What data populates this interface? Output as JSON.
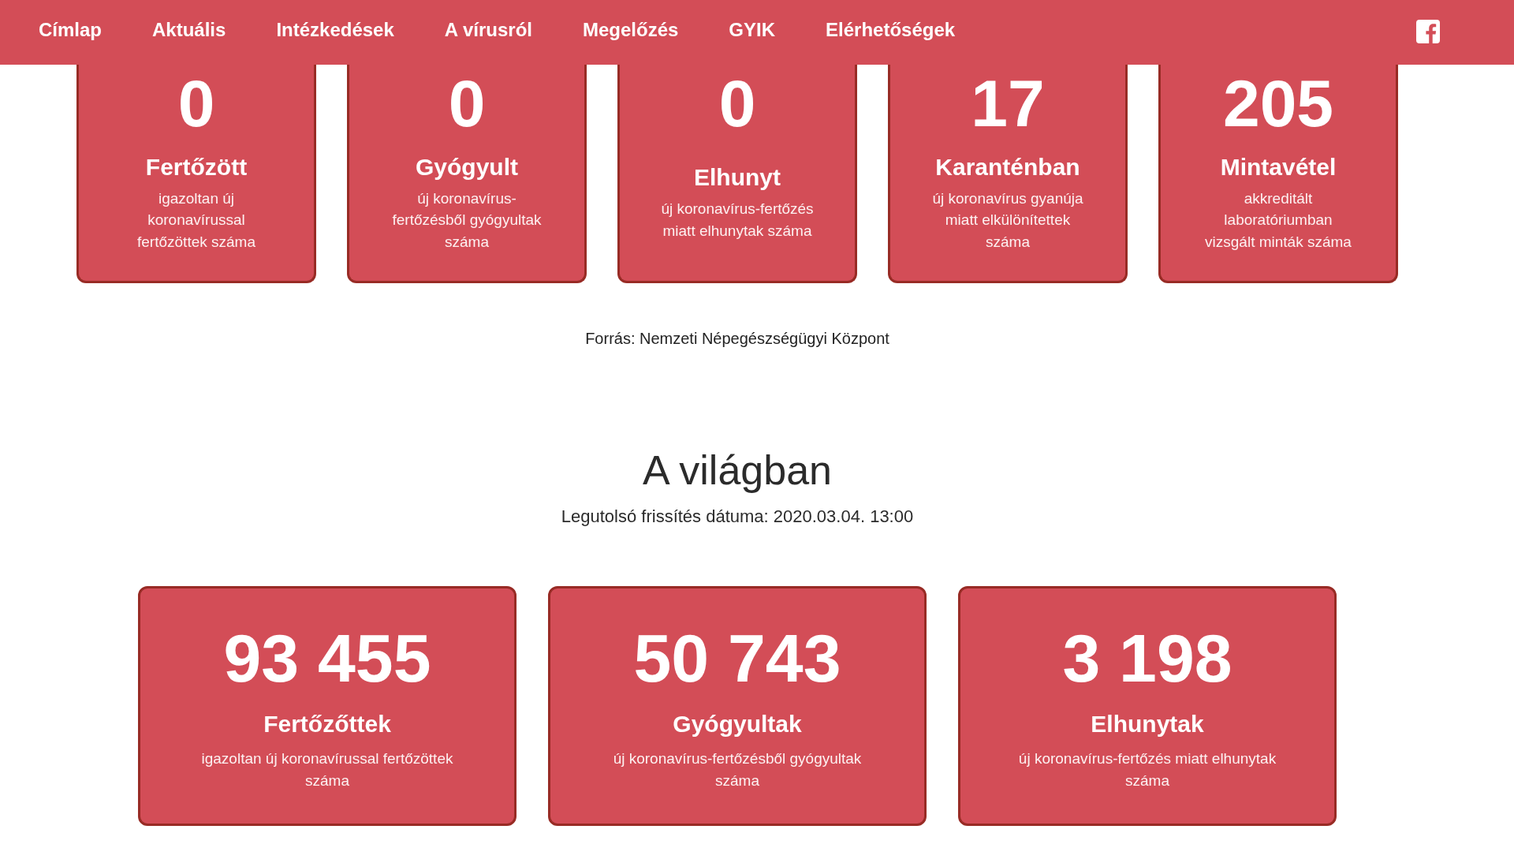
{
  "nav": {
    "links": [
      "Címlap",
      "Aktuális",
      "Intézkedések",
      "A vírusról",
      "Megelőzés",
      "GYIK",
      "Elérhetőségek"
    ]
  },
  "hungary": {
    "cards": [
      {
        "value": "0",
        "title": "Fertőzött",
        "description": "igazoltan új koronavírussal fertőzöttek száma"
      },
      {
        "value": "0",
        "title": "Gyógyult",
        "description": "új koronavírus-fertőzésből gyógyultak száma"
      },
      {
        "value": "0",
        "title": "Elhunyt",
        "description": "új koronavírus-fertőzés miatt elhunytak száma"
      },
      {
        "value": "17",
        "title": "Karanténban",
        "description": "új koronavírus gyanúja miatt elkülönítettek száma"
      },
      {
        "value": "205",
        "title": "Mintavétel",
        "description": "akkreditált laboratóriumban vizsgált minták száma"
      }
    ],
    "source": "Forrás: Nemzeti Népegészségügyi Központ"
  },
  "world": {
    "heading": "A világban",
    "updated": "Legutolsó frissítés dátuma: 2020.03.04. 13:00",
    "cards": [
      {
        "value": "93 455",
        "title": "Fertőzőttek",
        "description": "igazoltan új koronavírussal fertőzöttek száma"
      },
      {
        "value": "50 743",
        "title": "Gyógyultak",
        "description": "új koronavírus-fertőzésből gyógyultak száma"
      },
      {
        "value": "3 198",
        "title": "Elhunytak",
        "description": "új koronavírus-fertőzés miatt elhunytak száma"
      }
    ]
  }
}
